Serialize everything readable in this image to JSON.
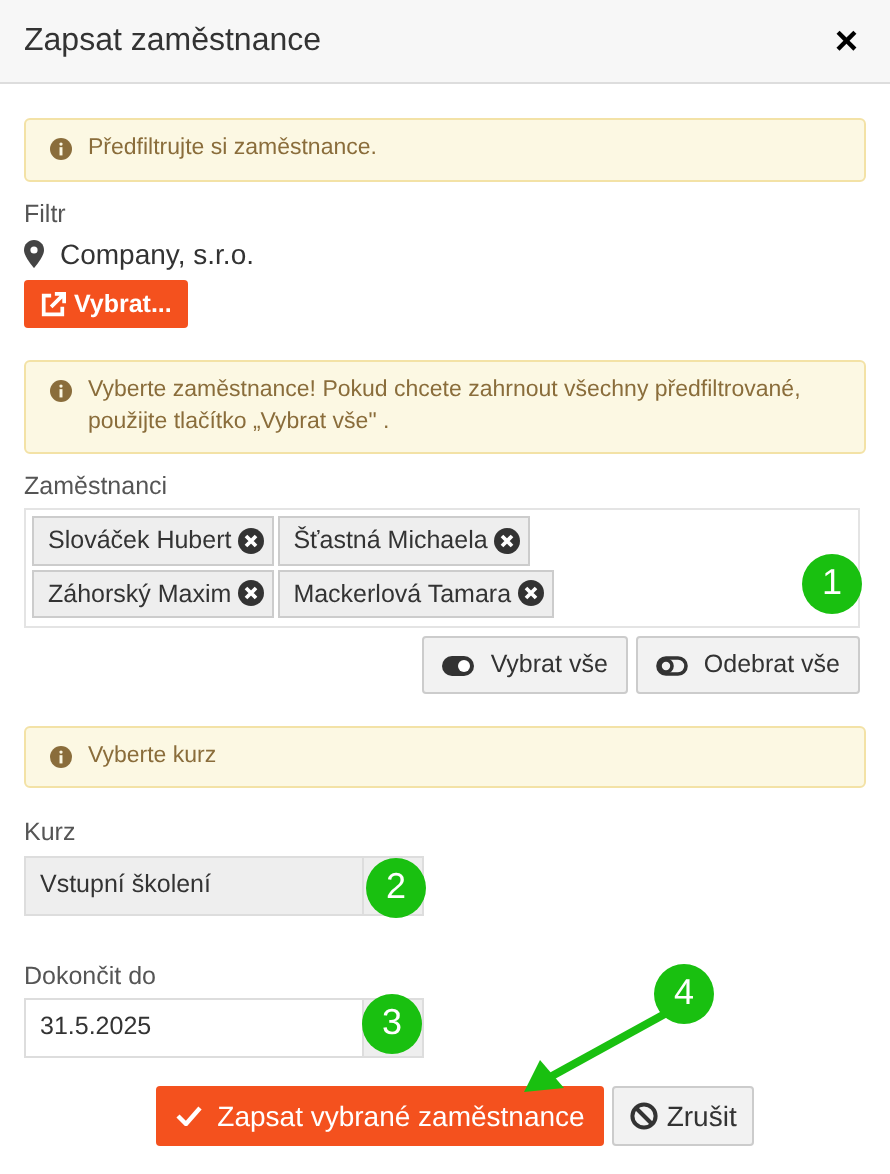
{
  "dialog": {
    "title": "Zapsat zaměstnance",
    "close": "×"
  },
  "filter_alert": "Předfiltrujte si zaměstnance.",
  "filter": {
    "label": "Filtr",
    "value": "Company, s.r.o.",
    "button": "Vybrat..."
  },
  "employees_alert": "Vyberte zaměstnance! Pokud chcete zahrnout všechny předfiltrované, použijte tlačítko „Vybrat vše\" .",
  "employees": {
    "label": "Zaměstnanci",
    "tags": [
      "Slováček Hubert",
      "Šťastná Michaela",
      "Záhorský Maxim",
      "Mackerlová Tamara"
    ],
    "select_all": "Vybrat vše",
    "remove_all": "Odebrat vše"
  },
  "course_alert": "Vyberte kurz",
  "course": {
    "label": "Kurz",
    "value": "Vstupní školení"
  },
  "due": {
    "label": "Dokončit do",
    "value": "31.5.2025"
  },
  "buttons": {
    "submit": "Zapsat vybrané zaměstnance",
    "cancel": "Zrušit"
  },
  "callouts": [
    "1",
    "2",
    "3",
    "4"
  ]
}
